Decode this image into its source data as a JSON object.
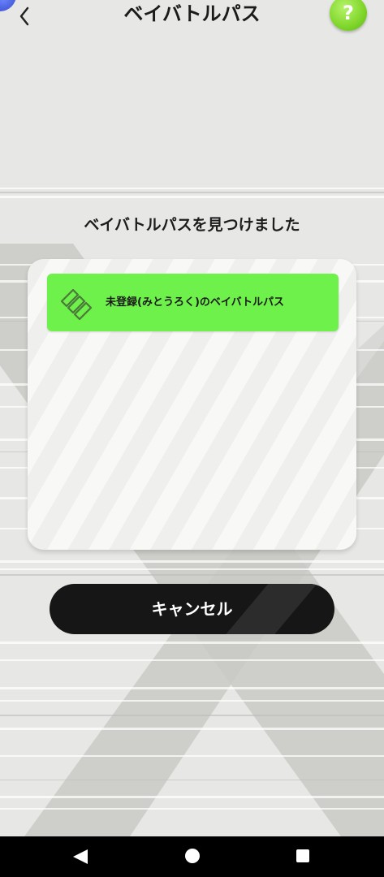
{
  "header": {
    "title": "ベイバトルパス",
    "back_icon": "chevron-left-icon",
    "help_label": "?"
  },
  "main": {
    "subtitle": "ベイバトルパスを見つけました",
    "passes": [
      {
        "label": "未登録(みとうろく)のベイバトルパス",
        "icon": "battle-pass-icon",
        "color": "#6ff14b"
      }
    ],
    "cancel_label": "キャンセル"
  },
  "system_nav": {
    "back": "back-triangle-icon",
    "home": "home-circle-icon",
    "recents": "recents-square-icon"
  },
  "colors": {
    "accent_green": "#6ff14b",
    "help_green": "#7fd62a",
    "button_dark": "#161616",
    "background": "#e7e7e5"
  }
}
